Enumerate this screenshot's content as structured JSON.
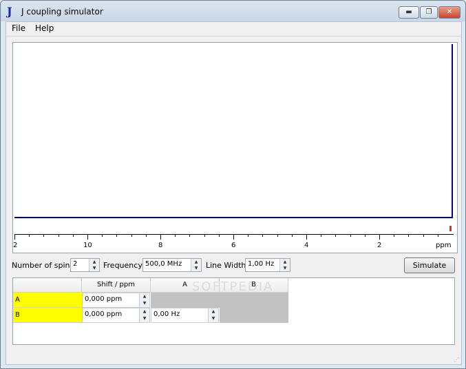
{
  "window": {
    "title": "J coupling simulator",
    "icon": "J"
  },
  "titlebar_buttons": {
    "minimize": "▬",
    "maximize": "❐",
    "close": "✕"
  },
  "menu": [
    "File",
    "Help"
  ],
  "plot": {
    "axis_ticks": [
      "2",
      "10",
      "8",
      "6",
      "4",
      "2",
      "ppm"
    ],
    "baseline_color": "#00008b"
  },
  "controls": {
    "spins_label": "Number of spins",
    "spins_value": "2",
    "frequency_label": "Frequency",
    "frequency_value": "500,0 MHz",
    "linewidth_label": "Line Width",
    "linewidth_value": "1,00 Hz",
    "simulate_label": "Simulate"
  },
  "table": {
    "headers": [
      "Shift / ppm",
      "A",
      "B"
    ],
    "rows": [
      {
        "name": "A",
        "shift": "0,000 ppm"
      },
      {
        "name": "B",
        "shift": "0,000 ppm",
        "j_a": "0,00 Hz"
      }
    ]
  },
  "watermark": "SOFTPEDIA"
}
